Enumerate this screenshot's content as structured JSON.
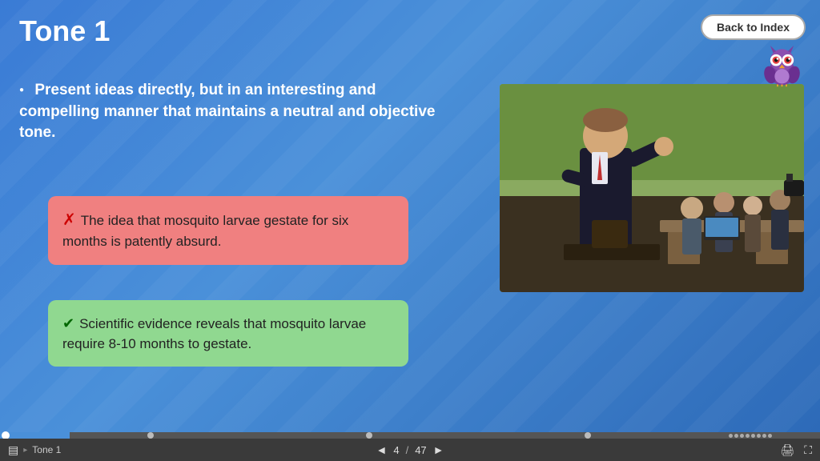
{
  "header": {
    "title": "Tone 1",
    "back_button_label": "Back to Index"
  },
  "bullet": {
    "text": "Present ideas directly, but in an interesting and compelling manner that maintains a neutral and objective tone."
  },
  "red_box": {
    "icon": "✗",
    "text": "The idea that mosquito larvae gestate for six months is patently absurd."
  },
  "green_box": {
    "icon": "✓",
    "text": "Scientific evidence reveals that mosquito larvae require 8-10 months to gestate."
  },
  "nav": {
    "slide_label": "Tone 1",
    "page_current": "4",
    "page_separator": "/",
    "page_total": "47"
  },
  "progress": {
    "percent": 8.5
  }
}
